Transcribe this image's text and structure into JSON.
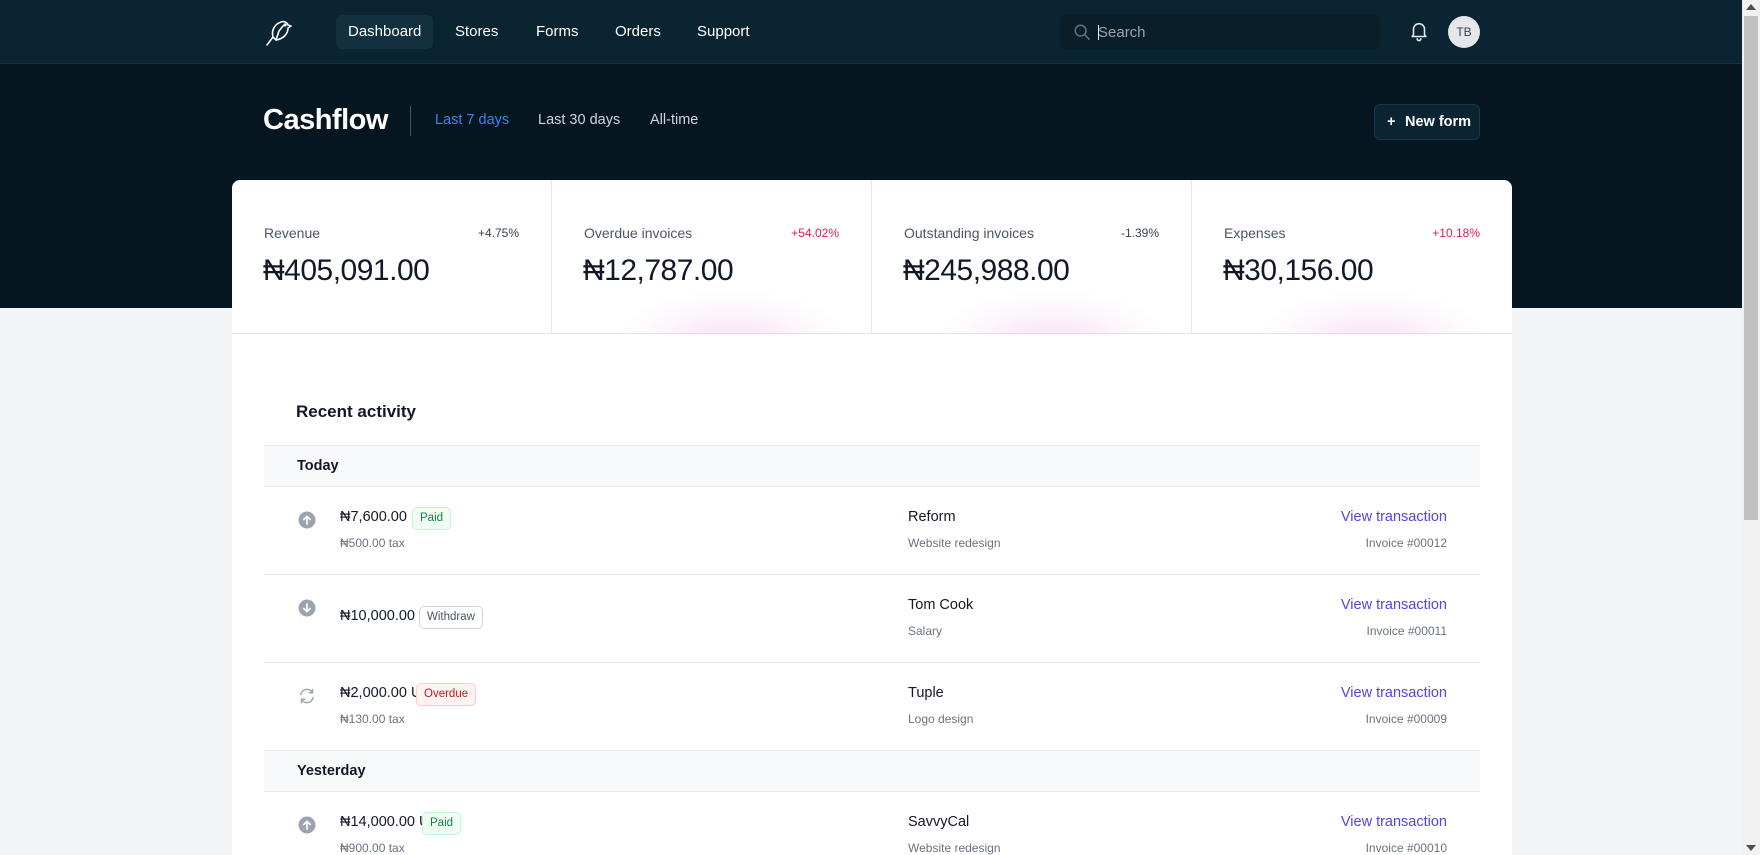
{
  "nav": {
    "items": [
      {
        "label": "Dashboard",
        "active": true
      },
      {
        "label": "Stores",
        "active": false
      },
      {
        "label": "Forms",
        "active": false
      },
      {
        "label": "Orders",
        "active": false
      },
      {
        "label": "Support",
        "active": false
      }
    ],
    "search": {
      "placeholder": "Search",
      "value": ""
    },
    "avatar_initials": "TB",
    "icons": {
      "logo": "bird-logo-icon",
      "search": "search-icon",
      "notifications": "bell-icon"
    }
  },
  "header": {
    "title": "Cashflow",
    "ranges": [
      {
        "label": "Last 7 days",
        "active": true
      },
      {
        "label": "Last 30 days",
        "active": false
      },
      {
        "label": "All-time",
        "active": false
      }
    ],
    "new_button": {
      "icon": "+",
      "label": "New form"
    }
  },
  "stats": [
    {
      "label": "Revenue",
      "change": "+4.75%",
      "change_color": "#374151",
      "value": "₦405,091.00"
    },
    {
      "label": "Overdue invoices",
      "change": "+54.02%",
      "change_color": "#e11d48",
      "value": "₦12,787.00"
    },
    {
      "label": "Outstanding invoices",
      "change": "-1.39%",
      "change_color": "#374151",
      "value": "₦245,988.00"
    },
    {
      "label": "Expenses",
      "change": "+10.18%",
      "change_color": "#e11d48",
      "value": "₦30,156.00"
    }
  ],
  "activity": {
    "title": "Recent activity",
    "groups": [
      {
        "label": "Today",
        "rows": [
          {
            "icon": "arrow-up-circle-icon",
            "amount": "₦7,600.00 USD",
            "status": "Paid",
            "tax": "₦500.00 tax",
            "client": "Reform",
            "description": "Website redesign",
            "link": "View transaction",
            "invoice": "Invoice #00012"
          },
          {
            "icon": "arrow-down-circle-icon",
            "amount": "₦10,000.00 USD",
            "status": "Withdraw",
            "tax": "",
            "client": "Tom Cook",
            "description": "Salary",
            "link": "View transaction",
            "invoice": "Invoice #00011"
          },
          {
            "icon": "refresh-icon",
            "amount": "₦2,000.00 USD",
            "status": "Overdue",
            "tax": "₦130.00 tax",
            "client": "Tuple",
            "description": "Logo design",
            "link": "View transaction",
            "invoice": "Invoice #00009"
          }
        ]
      },
      {
        "label": "Yesterday",
        "rows": [
          {
            "icon": "arrow-up-circle-icon",
            "amount": "₦14,000.00 USD",
            "status": "Paid",
            "tax": "₦900.00 tax",
            "client": "SavvyCal",
            "description": "Website redesign",
            "link": "View transaction",
            "invoice": "Invoice #00010"
          }
        ]
      }
    ]
  },
  "colors": {
    "nav_bg": "#0b2432",
    "hero_bg": "#061620",
    "accent": "#3b82f6",
    "link": "#4f46e5",
    "negative": "#e11d48"
  }
}
